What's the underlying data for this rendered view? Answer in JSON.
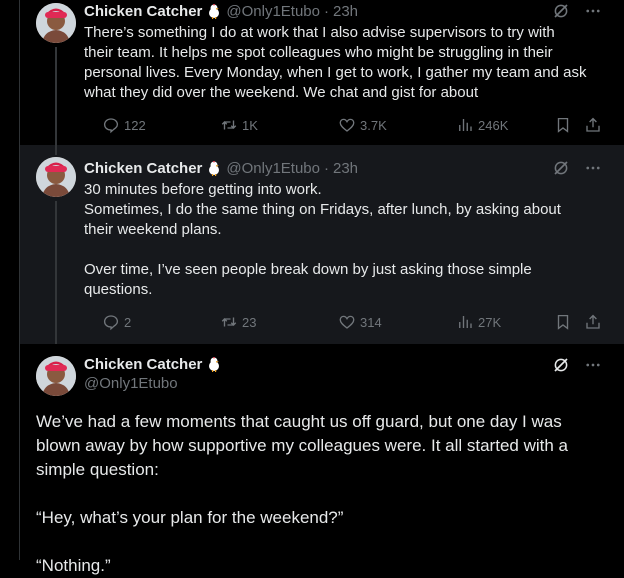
{
  "tweets": [
    {
      "author": "Chicken Catcher",
      "handle": "@Only1Etubo",
      "time": "23h",
      "lines": [
        "There’s something I do at work that I also advise supervisors to try with",
        "their team. It helps me spot colleagues who might be struggling in their",
        "personal lives. Every Monday, when I get to work, I gather my team and ask",
        "what they did over the weekend. We chat and gist for about"
      ],
      "replies": "122",
      "reposts": "1K",
      "likes": "3.7K",
      "views": "246K"
    },
    {
      "author": "Chicken Catcher",
      "handle": "@Only1Etubo",
      "time": "23h",
      "lines": [
        "30 minutes before getting into work.",
        "Sometimes, I do the same thing on Fridays, after lunch, by asking about",
        "their weekend plans.",
        "",
        "Over time, I’ve seen people break down by just asking those simple",
        "questions."
      ],
      "replies": "2",
      "reposts": "23",
      "likes": "314",
      "views": "27K"
    },
    {
      "author": "Chicken Catcher",
      "handle": "@Only1Etubo",
      "lines": [
        "We’ve had a few moments that caught us off guard, but one day I was",
        "blown away by how supportive my colleagues were. It all started with a",
        "simple question:",
        "",
        "“Hey, what’s your plan for the weekend?”",
        "",
        "“Nothing.”"
      ]
    }
  ],
  "separator": "·"
}
